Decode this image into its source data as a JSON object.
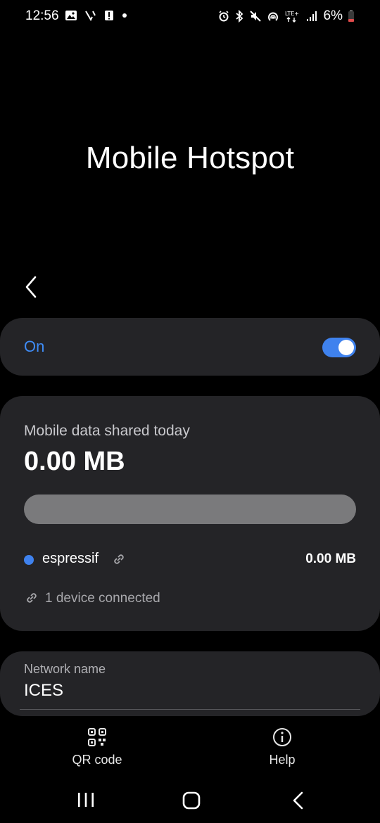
{
  "status_bar": {
    "time": "12:56",
    "battery_percent": "6%",
    "network_type": "LTE+",
    "left_icons": [
      "image-icon",
      "missed-call-icon",
      "alert-icon",
      "dot-icon"
    ],
    "right_icons": [
      "alarm-icon",
      "bluetooth-icon",
      "mute-icon",
      "hotspot-icon",
      "lte-icon",
      "signal-icon",
      "battery-low-icon"
    ],
    "battery_level": 0.06,
    "battery_color": "#e24b4b"
  },
  "page": {
    "title": "Mobile Hotspot"
  },
  "hotspot_toggle": {
    "label": "On",
    "enabled": true,
    "accent": "#3f82ee"
  },
  "usage": {
    "caption": "Mobile data shared today",
    "amount": "0.00 MB",
    "usage_fraction": 0,
    "devices": [
      {
        "name": "espressif",
        "usage": "0.00 MB",
        "dot_color": "#3f82ee"
      }
    ],
    "connected_summary": "1 device connected"
  },
  "network": {
    "label": "Network name",
    "value": "ICES"
  },
  "bottom_actions": {
    "qr_label": "QR code",
    "help_label": "Help"
  },
  "navbar": {
    "buttons": [
      "recent-apps",
      "home",
      "back"
    ]
  }
}
